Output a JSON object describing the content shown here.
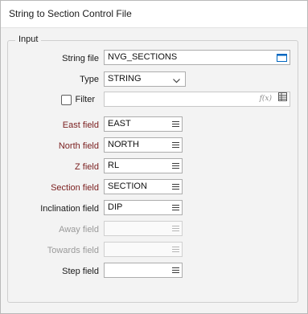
{
  "window": {
    "title": "String to Section Control File"
  },
  "input_group": {
    "legend": "Input"
  },
  "string_file": {
    "label": "String file",
    "value": "NVG_SECTIONS"
  },
  "type": {
    "label": "Type",
    "value": "STRING"
  },
  "filter": {
    "label": "Filter",
    "value": "",
    "fx": "f(x)"
  },
  "fields": {
    "east": {
      "label": "East field",
      "value": "EAST"
    },
    "north": {
      "label": "North field",
      "value": "NORTH"
    },
    "z": {
      "label": "Z field",
      "value": "RL"
    },
    "section": {
      "label": "Section field",
      "value": "SECTION"
    },
    "inclination": {
      "label": "Inclination field",
      "value": "DIP"
    },
    "away": {
      "label": "Away field",
      "value": ""
    },
    "towards": {
      "label": "Towards field",
      "value": ""
    },
    "step": {
      "label": "Step field",
      "value": ""
    }
  },
  "colors": {
    "required_label": "#7a1e1e",
    "disabled_label": "#9a9a9a",
    "accent": "#0067c0"
  },
  "icons": [
    "folder-open-icon",
    "chevron-down-icon",
    "list-icon",
    "expression-fx-icon",
    "table-icon"
  ]
}
